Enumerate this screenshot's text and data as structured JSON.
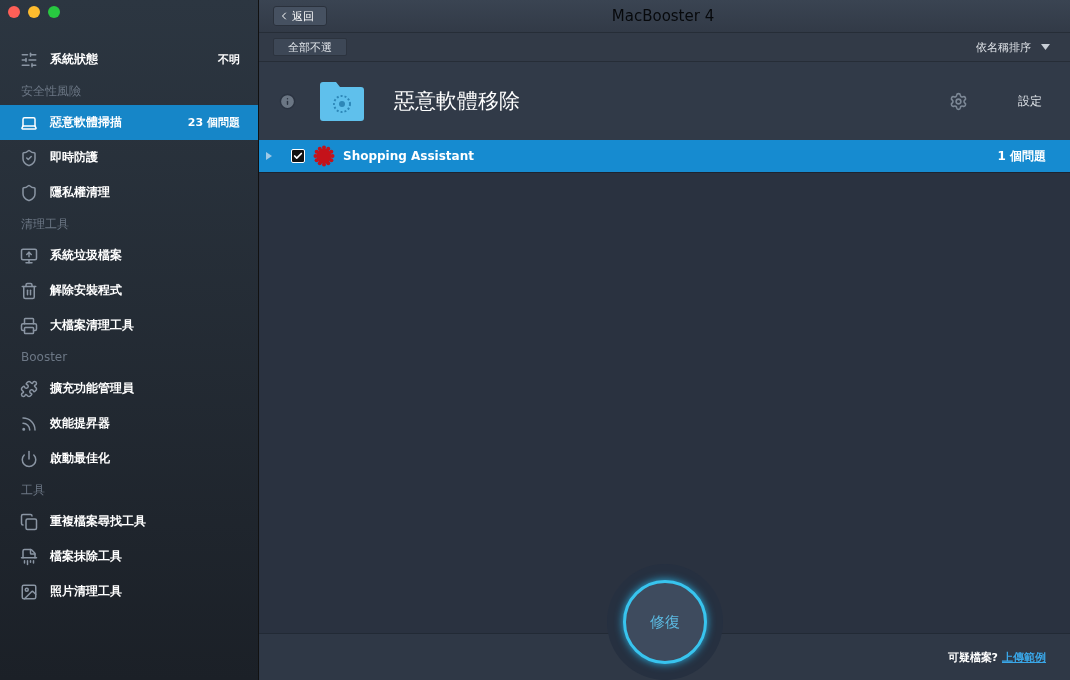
{
  "window": {
    "title": "MacBooster 4"
  },
  "sidebar": {
    "items": [
      {
        "kind": "item",
        "label": "系統狀態",
        "badge": "不明",
        "selected": false
      },
      {
        "kind": "section",
        "label": "安全性風險"
      },
      {
        "kind": "item",
        "label": "惡意軟體掃描",
        "badge": "23 個問題",
        "selected": true
      },
      {
        "kind": "item",
        "label": "即時防護",
        "selected": false
      },
      {
        "kind": "item",
        "label": "隱私權清理",
        "selected": false
      },
      {
        "kind": "section",
        "label": "清理工具"
      },
      {
        "kind": "item",
        "label": "系統垃圾檔案",
        "selected": false
      },
      {
        "kind": "item",
        "label": "解除安裝程式",
        "selected": false
      },
      {
        "kind": "item",
        "label": "大檔案清理工具",
        "selected": false
      },
      {
        "kind": "section",
        "label": "Booster"
      },
      {
        "kind": "item",
        "label": "擴充功能管理員",
        "selected": false
      },
      {
        "kind": "item",
        "label": "效能提昇器",
        "selected": false
      },
      {
        "kind": "item",
        "label": "啟動最佳化",
        "selected": false
      },
      {
        "kind": "section",
        "label": "工具"
      },
      {
        "kind": "item",
        "label": "重複檔案尋找工具",
        "selected": false
      },
      {
        "kind": "item",
        "label": "檔案抹除工具",
        "selected": false
      },
      {
        "kind": "item",
        "label": "照片清理工具",
        "selected": false
      }
    ]
  },
  "toolbar": {
    "back": "返回",
    "deselect_all": "全部不選",
    "sort": "依名稱排序"
  },
  "header": {
    "title": "惡意軟體移除",
    "settings": "設定"
  },
  "rows": [
    {
      "name": "Shopping Assistant",
      "issues": "1 個問題",
      "selected": true,
      "checked": true,
      "expanded": false
    }
  ],
  "footer": {
    "fix": "修復",
    "question": "可疑檔案?",
    "link": "上傳範例"
  }
}
